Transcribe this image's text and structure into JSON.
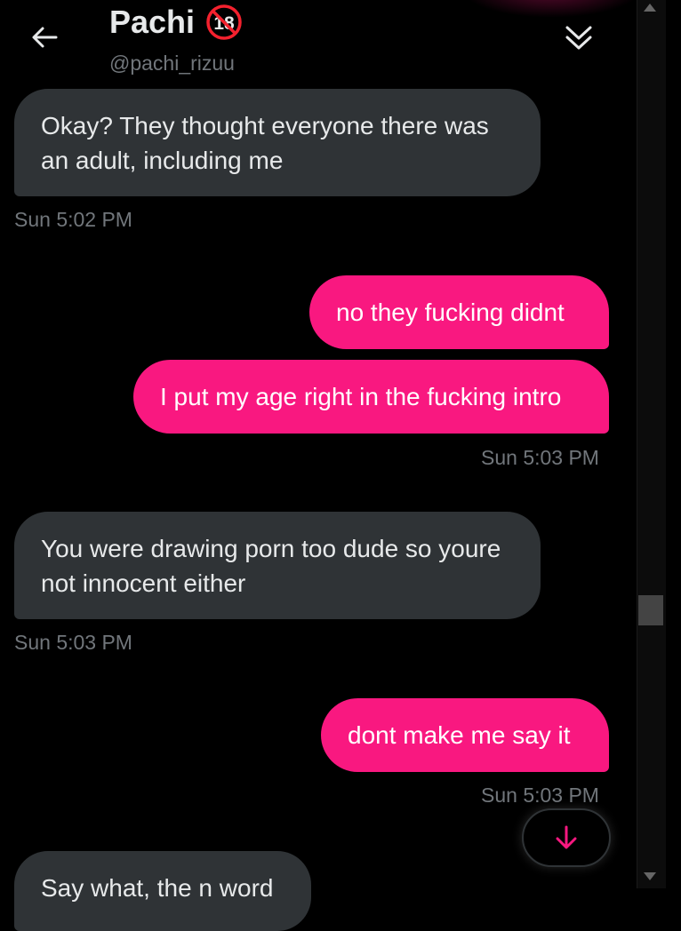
{
  "header": {
    "title": "Pachi",
    "badge_text": "18",
    "handle": "@pachi_rizuu",
    "icons": {
      "back": "back-arrow-icon",
      "badge": "no-18-icon",
      "collapse": "double-chevron-down-icon"
    }
  },
  "messages": [
    {
      "dir": "in",
      "text": "Okay? They thought everyone there was an adult, including me"
    },
    {
      "type": "timestamp",
      "text": "Sun 5:02 PM"
    },
    {
      "dir": "out",
      "text": "no they fucking didnt"
    },
    {
      "dir": "out",
      "text": "I put my age right in the fucking intro"
    },
    {
      "type": "timestamp",
      "text": "Sun 5:03 PM"
    },
    {
      "dir": "in",
      "text": "You were drawing porn too dude so youre not innocent either"
    },
    {
      "type": "timestamp",
      "text": "Sun 5:03 PM"
    },
    {
      "dir": "out",
      "text": "dont make me say it"
    },
    {
      "type": "timestamp",
      "text": "Sun 5:03 PM"
    },
    {
      "dir": "in",
      "text": "Say what, the n word"
    }
  ],
  "jump_button": {
    "icon": "arrow-down-icon"
  },
  "colors": {
    "accent": "#f91880",
    "incoming_bubble": "#2f3336",
    "background": "#000000",
    "muted_text": "#71767b"
  }
}
